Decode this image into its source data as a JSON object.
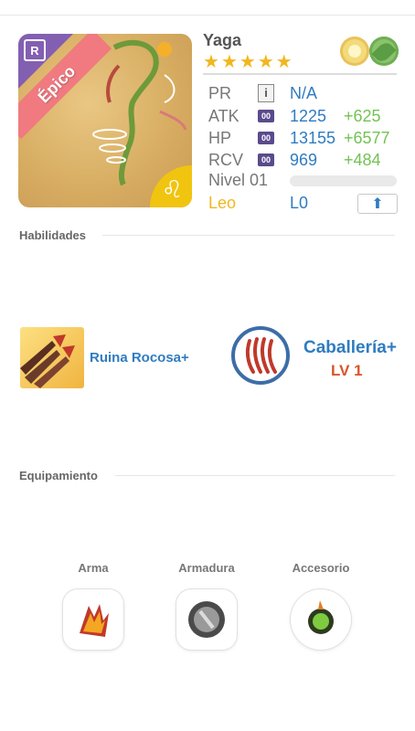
{
  "character": {
    "name": "Yaga",
    "rarity_label": "Épico",
    "badge_letter": "R",
    "zodiac_symbol": "♌",
    "stars": [
      "★",
      "★",
      "★",
      "★",
      "★"
    ]
  },
  "stats": {
    "pr": {
      "label": "PR",
      "icon": "i",
      "value": "N/A"
    },
    "atk": {
      "label": "ATK",
      "badge": "00",
      "value": "1225",
      "bonus": "+625"
    },
    "hp": {
      "label": "HP",
      "badge": "00",
      "value": "13155",
      "bonus": "+6577"
    },
    "rcv": {
      "label": "RCV",
      "badge": "00",
      "value": "969",
      "bonus": "+484"
    },
    "level": {
      "label": "Nivel 01",
      "progress": 0
    },
    "sign": {
      "label": "Leo",
      "value": "L0"
    }
  },
  "sections": {
    "skills": "Habilidades",
    "equipment": "Equipamiento"
  },
  "skills": {
    "skill1": {
      "label": "Ruina Rocosa+"
    },
    "skill2": {
      "label": "Caballería+",
      "level": "LV 1"
    }
  },
  "equipment": {
    "weapon": "Arma",
    "armor": "Armadura",
    "accessory": "Accesorio"
  },
  "colors": {
    "accent_blue": "#2f7cc0",
    "bonus_green": "#74c254",
    "star_yellow": "#f2b71e",
    "rarity_pink": "#f07a80"
  }
}
